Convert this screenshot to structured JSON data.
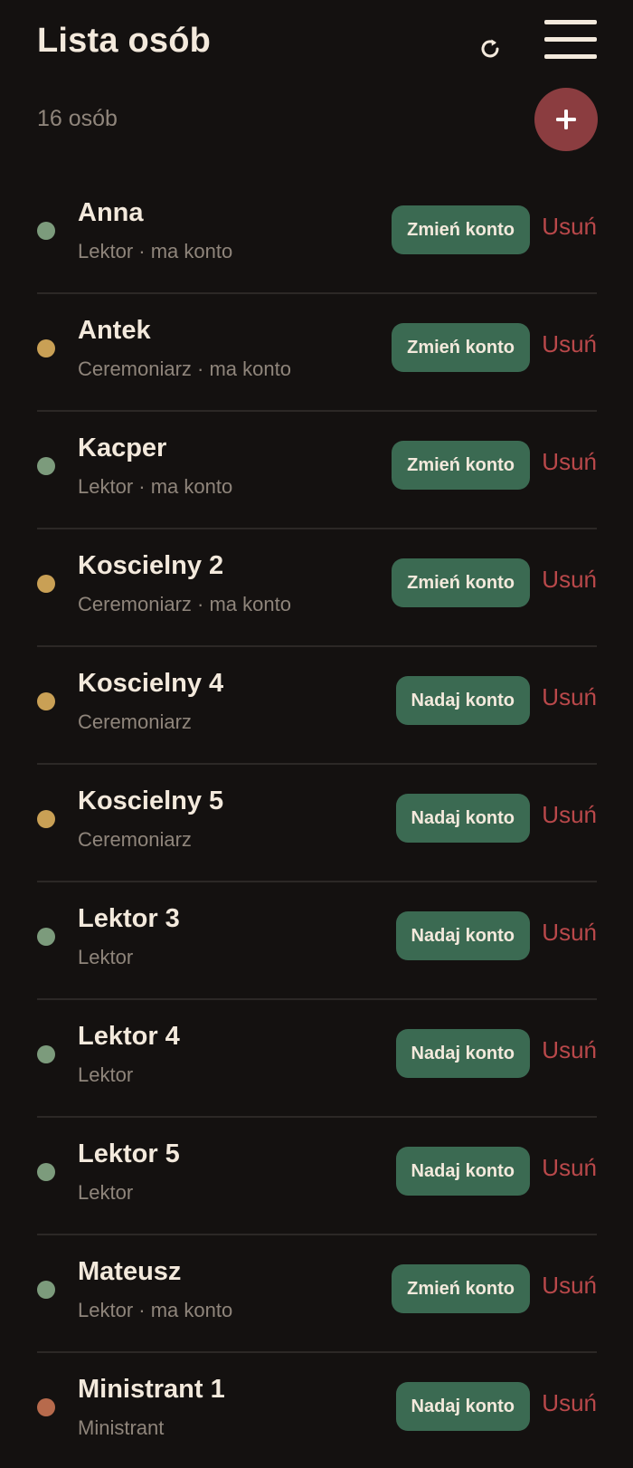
{
  "header": {
    "title": "Lista osób",
    "refresh_icon": "refresh-icon",
    "menu_icon": "hamburger-menu-icon"
  },
  "summary": {
    "count_text": "16 osób",
    "add_icon": "plus-icon"
  },
  "colors": {
    "background": "#141110",
    "accent_button": "#3b6a52",
    "add_button": "#8b3d40",
    "delete_text": "#b9484a",
    "role_lektor": "#7c9b7c",
    "role_ceremoniarz": "#c9a055",
    "role_ministrant": "#b76a4c"
  },
  "people": [
    {
      "name": "Anna",
      "meta": "Lektor · ma konto",
      "role_color": "#7c9b7c",
      "account_label": "Zmień konto",
      "delete_label": "Usuń"
    },
    {
      "name": "Antek",
      "meta": "Ceremoniarz · ma konto",
      "role_color": "#c9a055",
      "account_label": "Zmień konto",
      "delete_label": "Usuń"
    },
    {
      "name": "Kacper",
      "meta": "Lektor · ma konto",
      "role_color": "#7c9b7c",
      "account_label": "Zmień konto",
      "delete_label": "Usuń"
    },
    {
      "name": "Koscielny 2",
      "meta": "Ceremoniarz · ma konto",
      "role_color": "#c9a055",
      "account_label": "Zmień konto",
      "delete_label": "Usuń"
    },
    {
      "name": "Koscielny 4",
      "meta": "Ceremoniarz",
      "role_color": "#c9a055",
      "account_label": "Nadaj konto",
      "delete_label": "Usuń"
    },
    {
      "name": "Koscielny 5",
      "meta": "Ceremoniarz",
      "role_color": "#c9a055",
      "account_label": "Nadaj konto",
      "delete_label": "Usuń"
    },
    {
      "name": "Lektor 3",
      "meta": "Lektor",
      "role_color": "#7c9b7c",
      "account_label": "Nadaj konto",
      "delete_label": "Usuń"
    },
    {
      "name": "Lektor 4",
      "meta": "Lektor",
      "role_color": "#7c9b7c",
      "account_label": "Nadaj konto",
      "delete_label": "Usuń"
    },
    {
      "name": "Lektor 5",
      "meta": "Lektor",
      "role_color": "#7c9b7c",
      "account_label": "Nadaj konto",
      "delete_label": "Usuń"
    },
    {
      "name": "Mateusz",
      "meta": "Lektor · ma konto",
      "role_color": "#7c9b7c",
      "account_label": "Zmień konto",
      "delete_label": "Usuń"
    },
    {
      "name": "Ministrant 1",
      "meta": "Ministrant",
      "role_color": "#b76a4c",
      "account_label": "Nadaj konto",
      "delete_label": "Usuń"
    }
  ]
}
